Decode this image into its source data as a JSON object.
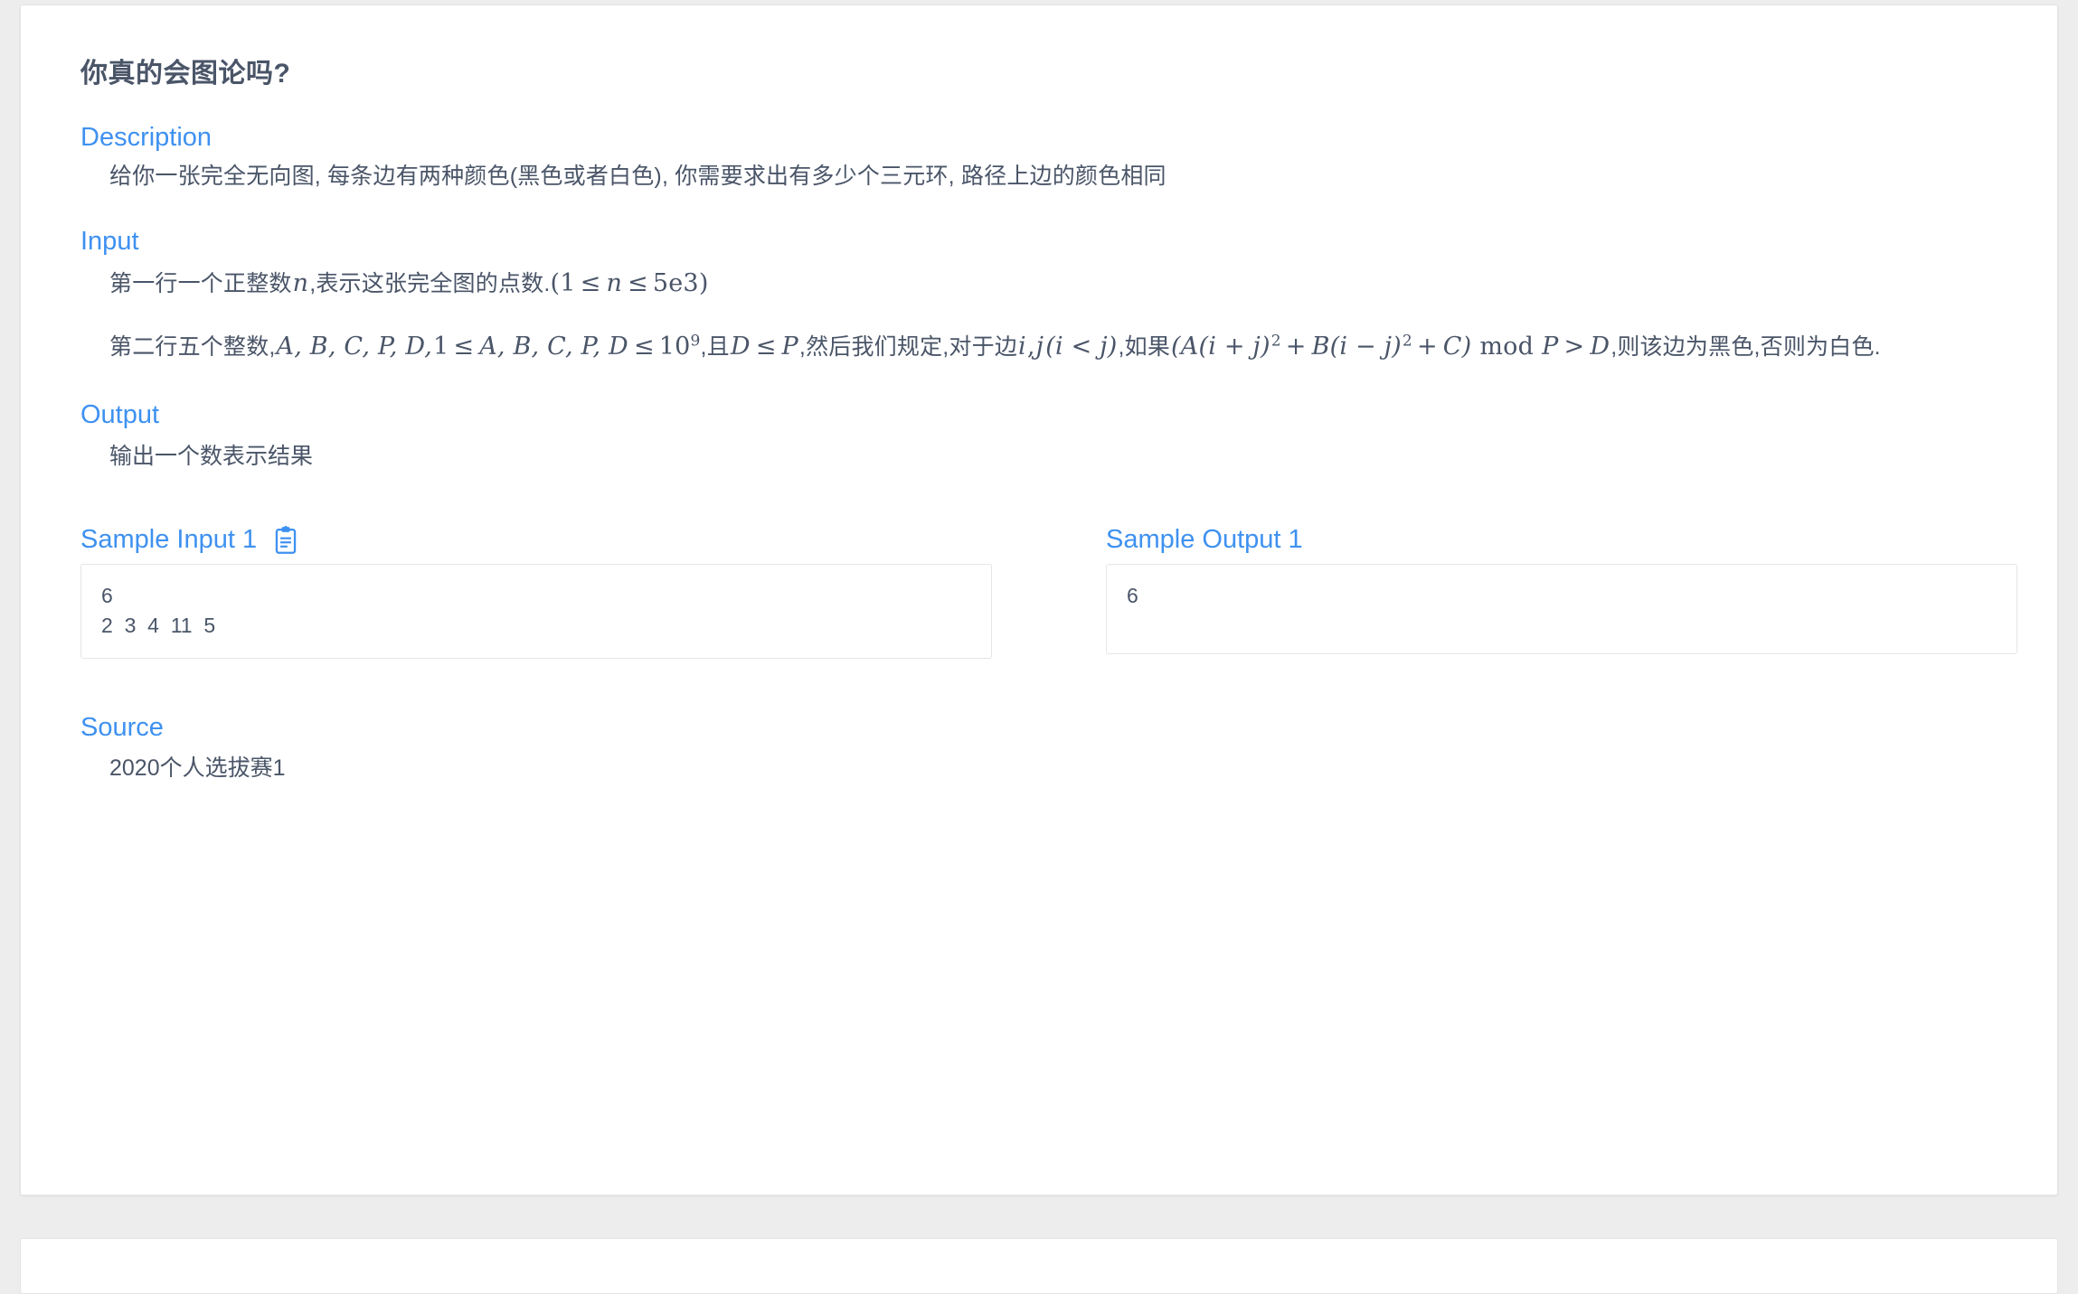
{
  "problem": {
    "title": "你真的会图论吗?",
    "sections": {
      "description": {
        "heading": "Description",
        "body": "给你一张完全无向图, 每条边有两种颜色(黑色或者白色), 你需要求出有多少个三元环, 路径上边的颜色相同"
      },
      "input": {
        "heading": "Input",
        "line1": {
          "text_before": "第一行一个正整数",
          "var_n": "n",
          "text_mid": ",表示这张完全图的点数.",
          "paren_open": "(",
          "num_1": "1",
          "le_1": "≤",
          "var_n2": "n",
          "le_2": "≤",
          "bound": "5e3",
          "paren_close": ")"
        },
        "line2": {
          "t1": "第二行五个整数,",
          "vars": "A, B, C, P, D,",
          "one": "1",
          "le1": "≤",
          "vars2": "A, B, C, P, D",
          "le2": "≤",
          "base": "10",
          "exp": "9",
          "t2": ",且",
          "varD": "D",
          "le3": "≤",
          "varP": "P",
          "t3": ",然后我们规定,对于边",
          "edge_i": "i",
          "comma": ",",
          "edge_j": "j",
          "cond": "(i < j)",
          "t4": ",如果",
          "formula_a": "(A(i + j)",
          "exp2a": "2",
          "plus": "+",
          "formula_b": "B(i − j)",
          "exp2b": "2",
          "plus2": "+",
          "formula_c": "C)",
          "modop": "mod",
          "varP2": "P",
          "gt": ">",
          "varD2": "D",
          "t5": ",则该边为黑色,否则为白色."
        }
      },
      "output": {
        "heading": "Output",
        "body": "输出一个数表示结果"
      },
      "source": {
        "heading": "Source",
        "body": "2020个人选拔赛1"
      }
    },
    "samples": {
      "input": {
        "heading": "Sample Input 1",
        "copy_icon": "clipboard-copy-icon",
        "content": "6\n2  3  4  11  5"
      },
      "output": {
        "heading": "Sample Output 1",
        "content": "6"
      }
    }
  },
  "colors": {
    "accent": "#3e91f0",
    "text": "#4a5568",
    "page_bg": "#ededed",
    "card_bg": "#ffffff",
    "border": "#e3e6e8"
  }
}
